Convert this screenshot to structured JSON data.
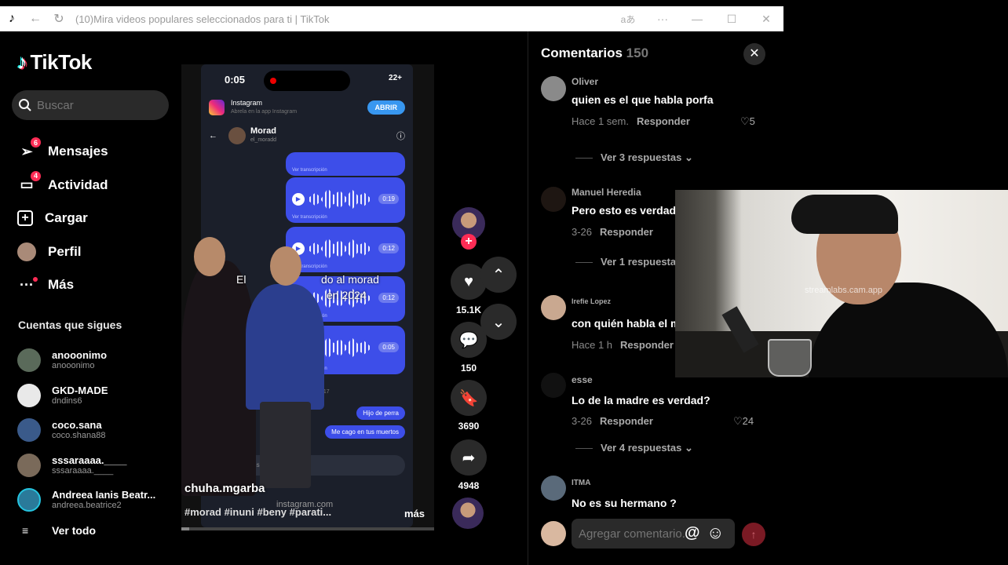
{
  "browser": {
    "title": "(10)Mira videos populares seleccionados para ti | TikTok",
    "back_icon": "back-arrow-icon",
    "reload_icon": "reload-icon",
    "translate_icon": "translate-icon",
    "more_icon": "more-dots-icon"
  },
  "sidebar": {
    "logo_text": "TikTok",
    "search": {
      "placeholder": "Buscar"
    },
    "nav": [
      {
        "label": "Mensajes",
        "icon": "send-icon",
        "badge": "6"
      },
      {
        "label": "Actividad",
        "icon": "inbox-icon",
        "badge": "4"
      },
      {
        "label": "Cargar",
        "icon": "upload-icon",
        "badge": ""
      },
      {
        "label": "Perfil",
        "icon": "profile-avatar",
        "badge": ""
      },
      {
        "label": "Más",
        "icon": "more-icon",
        "badge": ""
      }
    ],
    "following_title": "Cuentas que sigues",
    "following": [
      {
        "name": "anooonimo",
        "user": "anooonimo",
        "color": "#5a6a5a"
      },
      {
        "name": "GKD-MADE",
        "user": "dndins6",
        "color": "#e9e9e9"
      },
      {
        "name": "coco.sana",
        "user": "coco.shana88",
        "color": "#3a5a8a"
      },
      {
        "name": "sssaraaaa.____",
        "user": "sssaraaaa.____",
        "color": "#7a6a5a"
      },
      {
        "name": "Andreea Ianis Beatr...",
        "user": "andreea.beatrice2",
        "color": "#2a7a9a"
      }
    ],
    "see_all": "Ver todo"
  },
  "video": {
    "phone_time": "0:05",
    "phone_status": "22+",
    "ig_app": "Instagram",
    "ig_sub": "Abrela en la app Instagram",
    "ig_open": "ABRIR",
    "chat_name": "Morad",
    "chat_user": "el_moradd",
    "transcription": "Ver transcripción",
    "voice_durations": [
      "0:19",
      "0:12",
      "0:12",
      "0:05"
    ],
    "overlay_line1": "El",
    "overlay_line1b": "do al morad",
    "overlay_line2": "en 2024",
    "time_mark": "0:17",
    "msg1": "Hijo de perra",
    "msg2": "Me cago en tus muertos",
    "composer": "Mensaje...",
    "ig_footer": "instagram.com",
    "author": "chuha.mgarba",
    "hashtags": "#morad #inuni #beny #parati...",
    "more": "más",
    "progress": 0.03
  },
  "actions": {
    "likes": "15.1K",
    "comments": "150",
    "saves": "3690",
    "shares": "4948"
  },
  "comments": {
    "title": "Comentarios",
    "count": "150",
    "items": [
      {
        "user": "Oliver",
        "text": "quien es el que habla porfa",
        "time": "Hace 1 sem.",
        "reply": "Responder",
        "likes": "5",
        "replies": "Ver 3 respuestas",
        "color": "#8a8a8a"
      },
      {
        "user": "Manuel Heredia",
        "text": "Pero esto es verdad",
        "time": "3-26",
        "reply": "Responder",
        "likes": "",
        "replies": "Ver 1 respuesta",
        "color": "#4a3a2a"
      },
      {
        "user": "Irefie Lopez",
        "text": "con quién habla el m",
        "time": "Hace 1 h",
        "reply": "Responder",
        "likes": "",
        "replies": "",
        "color": "#c9a890"
      },
      {
        "user": "esse",
        "text": "Lo de la madre es verdad?",
        "time": "3-26",
        "reply": "Responder",
        "likes": "24",
        "replies": "Ver 4 respuestas",
        "color": "#222222"
      },
      {
        "user": "ITMA",
        "text": "No es su hermano ?",
        "time": "",
        "reply": "",
        "likes": "",
        "replies": "",
        "color": "#5a6a7a"
      }
    ],
    "add_placeholder": "Agregar comentario...",
    "at_symbol": "@"
  },
  "webcam": {
    "watermark": "streamlabs.cam.app"
  }
}
